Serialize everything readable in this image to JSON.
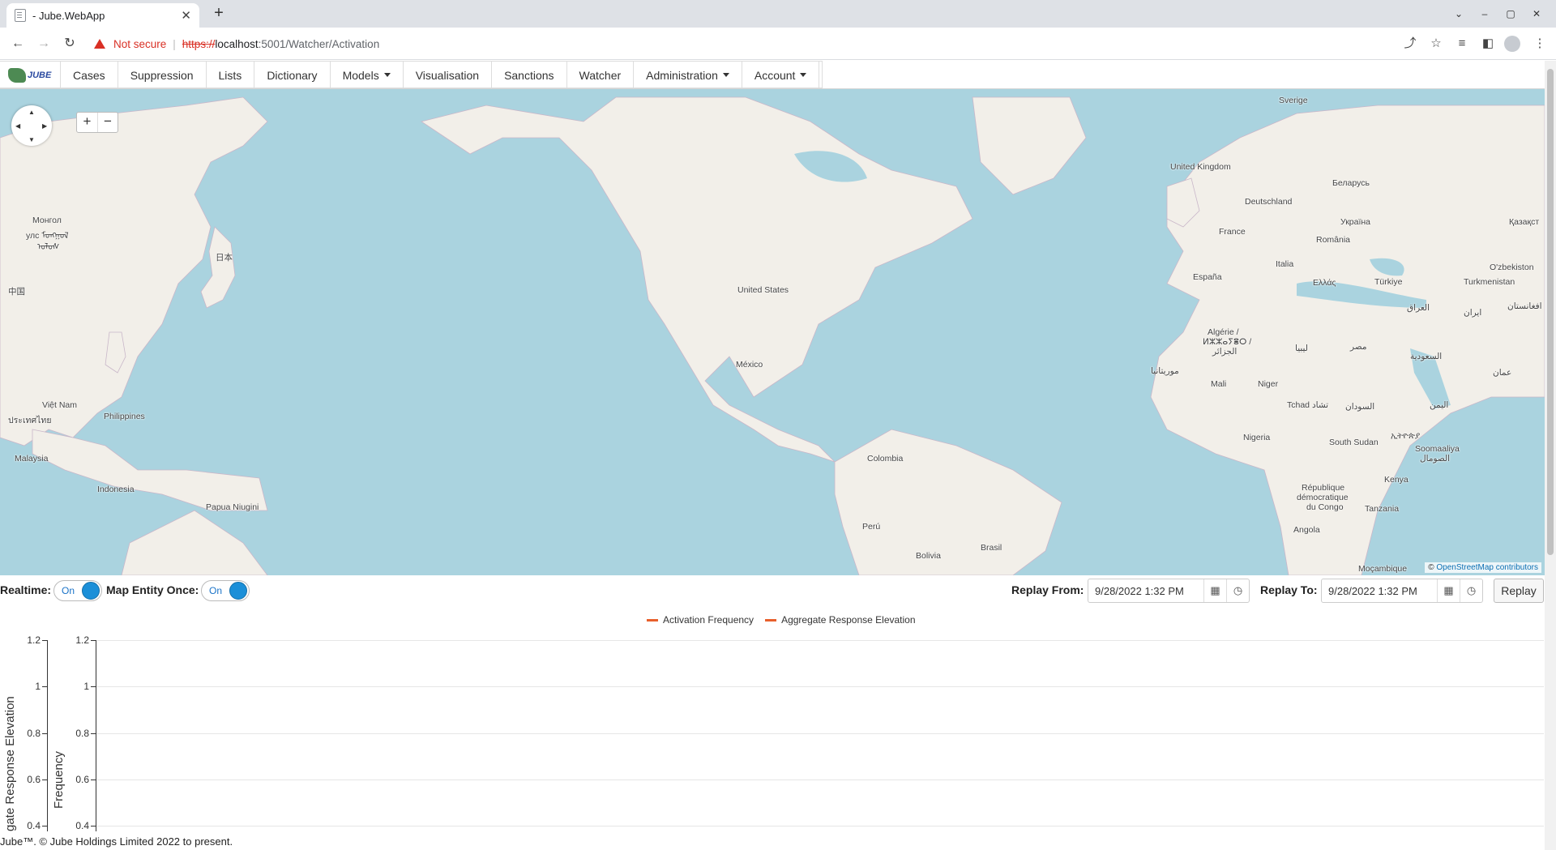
{
  "browser": {
    "tab_title": "- Jube.WebApp",
    "tab_close": "✕",
    "new_tab": "+",
    "security_label": "Not secure",
    "url_scheme": "https://",
    "url_host": "localhost",
    "url_path": ":5001/Watcher/Activation",
    "window_buttons": [
      "⌄",
      "–",
      "▢",
      "✕"
    ]
  },
  "nav": {
    "logo_text": "JUBE",
    "items": [
      {
        "label": "Cases",
        "dropdown": false
      },
      {
        "label": "Suppression",
        "dropdown": false
      },
      {
        "label": "Lists",
        "dropdown": false
      },
      {
        "label": "Dictionary",
        "dropdown": false
      },
      {
        "label": "Models",
        "dropdown": true
      },
      {
        "label": "Visualisation",
        "dropdown": false
      },
      {
        "label": "Sanctions",
        "dropdown": false
      },
      {
        "label": "Watcher",
        "dropdown": false
      },
      {
        "label": "Administration",
        "dropdown": true
      },
      {
        "label": "Account",
        "dropdown": true
      }
    ]
  },
  "map": {
    "zoom_in": "+",
    "zoom_out": "−",
    "attribution_prefix": "© ",
    "attribution_link": "OpenStreetMap contributors",
    "labels": [
      "Sverige",
      "United Kingdom",
      "Беларусь",
      "Deutschland",
      "Україна",
      "Қазақст",
      "France",
      "România",
      "Italia",
      "España",
      "Ελλάς",
      "Türkiye",
      "O'zbekiston",
      "Turkmenistan",
      "افغانستان",
      "العراق",
      "ایران",
      "Algérie /",
      "ⵍⵣⵣⴰⵢⴻⵔ /",
      "الجزائر",
      "ليبيا",
      "مصر",
      "السعودية",
      "عمان",
      "موريتانيا",
      "Mali",
      "Niger",
      "Tchad تشاد",
      "السودان",
      "اليمن",
      "Nigeria",
      "South Sudan",
      "ኢትዮጵያ",
      "Soomaaliya",
      "الصومال",
      "Kenya",
      "République",
      "démocratique",
      "du Congo",
      "Tanzania",
      "Angola",
      "Moçambique",
      "United States",
      "México",
      "Colombia",
      "Perú",
      "Bolivia",
      "Brasil",
      "Монгол",
      "улс ᠮᠣᠩᠭᠣᠯ",
      "ᠤᠯᠤᠰ",
      "日本",
      "中国",
      "Việt Nam",
      "ประเทศไทย",
      "Philippines",
      "Malaysia",
      "Indonesia",
      "Papua Niugini"
    ]
  },
  "controls": {
    "realtime_label": "Realtime:",
    "realtime_value": "On",
    "map_entity_label": "Map Entity Once:",
    "map_entity_value": "On",
    "replay_from_label": "Replay From:",
    "replay_from_value": "9/28/2022 1:32 PM",
    "replay_to_label": "Replay To:",
    "replay_to_value": "9/28/2022 1:32 PM",
    "replay_button": "Replay",
    "calendar_icon": "▦",
    "clock_icon": "◷"
  },
  "chart_data": {
    "type": "line",
    "series": [
      {
        "name": "Activation Frequency",
        "values": []
      },
      {
        "name": "Aggregate Response Elevation",
        "values": []
      }
    ],
    "series_color": "#e8602c",
    "ylabel_left": "gate Response Elevation",
    "ylabel_right": "Frequency",
    "yticks": [
      "1.2",
      "1",
      "0.8",
      "0.6",
      "0.4"
    ],
    "ylim_visible": [
      0.4,
      1.2
    ],
    "grid": true
  },
  "footer": "Jube™. © Jube Holdings Limited 2022 to present."
}
